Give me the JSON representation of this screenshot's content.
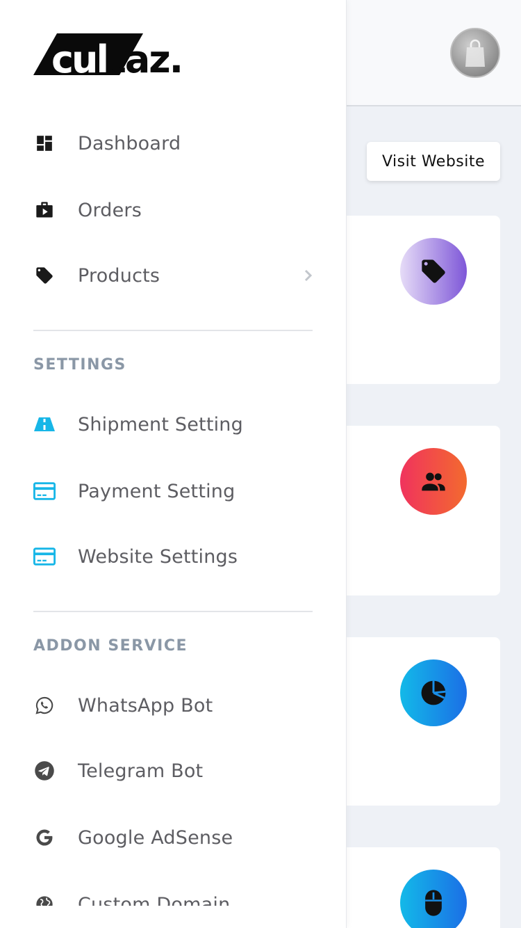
{
  "header": {
    "visit_website_label": "Visit Website",
    "avatar": {
      "icon": "shopping-bag-icon"
    }
  },
  "cards": [
    {
      "icon": "tag-icon",
      "gradient": [
        "#e6dcf7",
        "#7e57d8"
      ]
    },
    {
      "icon": "users-icon",
      "gradient": [
        "#f0335d",
        "#f36a2f"
      ]
    },
    {
      "icon": "pie-chart-icon",
      "gradient": [
        "#13b9e8",
        "#1b6fe6"
      ]
    },
    {
      "icon": "mouse-icon",
      "gradient": [
        "#13b9e8",
        "#1b6fe6"
      ]
    }
  ],
  "drawer": {
    "logo_text": "cultaz.",
    "main_items": [
      {
        "label": "Dashboard",
        "icon": "dashboard-icon"
      },
      {
        "label": "Orders",
        "icon": "briefcase-play-icon"
      },
      {
        "label": "Products",
        "icon": "tag-icon",
        "has_submenu": true
      }
    ],
    "settings_title": "SETTINGS",
    "settings_items": [
      {
        "label": "Shipment Setting",
        "icon": "road-icon"
      },
      {
        "label": "Payment Setting",
        "icon": "credit-card-icon"
      },
      {
        "label": "Website Settings",
        "icon": "credit-card-icon"
      }
    ],
    "addon_title": "ADDON SERVICE",
    "addon_items": [
      {
        "label": "WhatsApp Bot",
        "icon": "whatsapp-icon"
      },
      {
        "label": "Telegram Bot",
        "icon": "telegram-icon"
      },
      {
        "label": "Google AdSense",
        "icon": "google-icon"
      },
      {
        "label": "Custom Domain",
        "icon": "globe-icon"
      }
    ]
  },
  "colors": {
    "accent_cyan": "#1ab3e6",
    "icon_dark": "#1a1a1a",
    "section_title": "#8a97a6",
    "nav_text": "#5d5d62"
  }
}
